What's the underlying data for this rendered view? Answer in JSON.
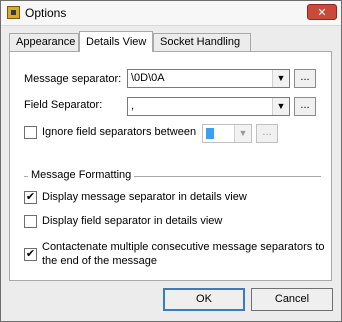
{
  "window": {
    "title": "Options",
    "close_symbol": "✕"
  },
  "tabs": [
    {
      "label": "Appearance",
      "active": false
    },
    {
      "label": "Details View",
      "active": true
    },
    {
      "label": "Socket Handling",
      "active": false
    }
  ],
  "fields": {
    "message_separator": {
      "label": "Message separator:",
      "value": "\\0D\\0A"
    },
    "field_separator": {
      "label": "Field Separator:",
      "value": ","
    },
    "ignore_between": {
      "label": "Ignore field separators between",
      "checked": false
    }
  },
  "message_formatting": {
    "title": "Message Formatting",
    "options": [
      {
        "label": "Display message separator in details view",
        "checked": true
      },
      {
        "label": "Display field separator in details view",
        "checked": false
      },
      {
        "label": "Contactenate multiple consecutive message separators to",
        "label2": "the end of the message",
        "checked": true
      }
    ]
  },
  "buttons": {
    "browse": "...",
    "ok": "OK",
    "cancel": "Cancel"
  },
  "colors": {
    "accent_blue": "#3ca0f0",
    "default_border": "#3b7bbf",
    "close_red": "#c94a3a"
  }
}
